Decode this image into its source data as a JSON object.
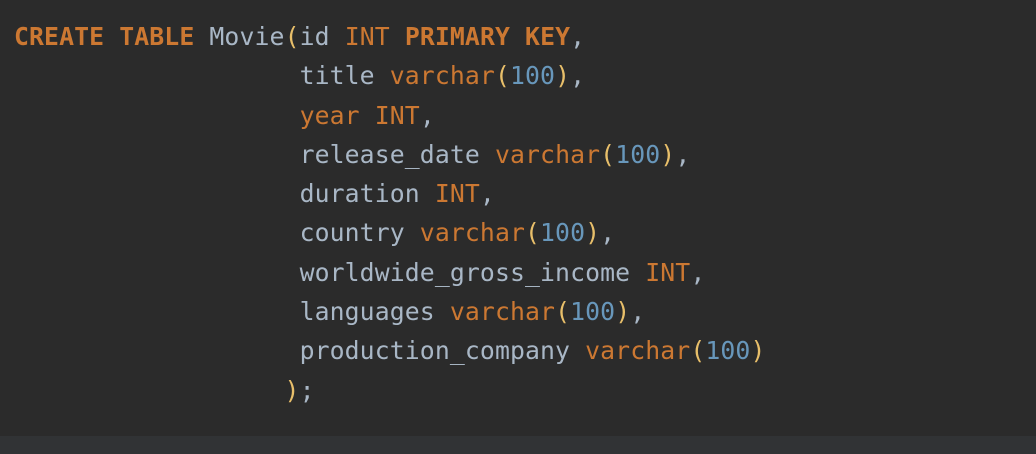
{
  "editor": {
    "colors": {
      "background": "#2b2b2b",
      "keyword": "#cc7832",
      "identifier": "#a9b7c6",
      "paren": "#e8bf6a",
      "number": "#6897bb"
    },
    "lines": [
      {
        "indent": "",
        "tokens": [
          {
            "t": "kw",
            "v": "CREATE"
          },
          {
            "t": "pn",
            "v": " "
          },
          {
            "t": "kw",
            "v": "TABLE"
          },
          {
            "t": "pn",
            "v": " "
          },
          {
            "t": "id",
            "v": "Movie"
          },
          {
            "t": "br",
            "v": "("
          },
          {
            "t": "id",
            "v": "id"
          },
          {
            "t": "pn",
            "v": " "
          },
          {
            "t": "ty",
            "v": "INT"
          },
          {
            "t": "pn",
            "v": " "
          },
          {
            "t": "kw",
            "v": "PRIMARY"
          },
          {
            "t": "pn",
            "v": " "
          },
          {
            "t": "kw",
            "v": "KEY"
          },
          {
            "t": "pn",
            "v": ","
          }
        ]
      },
      {
        "indent": "                   ",
        "tokens": [
          {
            "t": "id",
            "v": "title"
          },
          {
            "t": "pn",
            "v": " "
          },
          {
            "t": "ty",
            "v": "varchar"
          },
          {
            "t": "br",
            "v": "("
          },
          {
            "t": "num",
            "v": "100"
          },
          {
            "t": "br",
            "v": ")"
          },
          {
            "t": "pn",
            "v": ","
          }
        ]
      },
      {
        "indent": "                   ",
        "tokens": [
          {
            "t": "ty",
            "v": "year"
          },
          {
            "t": "pn",
            "v": " "
          },
          {
            "t": "ty",
            "v": "INT"
          },
          {
            "t": "pn",
            "v": ","
          }
        ]
      },
      {
        "indent": "                   ",
        "tokens": [
          {
            "t": "id",
            "v": "release_date"
          },
          {
            "t": "pn",
            "v": " "
          },
          {
            "t": "ty",
            "v": "varchar"
          },
          {
            "t": "br",
            "v": "("
          },
          {
            "t": "num",
            "v": "100"
          },
          {
            "t": "br",
            "v": ")"
          },
          {
            "t": "pn",
            "v": ","
          }
        ]
      },
      {
        "indent": "                   ",
        "tokens": [
          {
            "t": "id",
            "v": "duration"
          },
          {
            "t": "pn",
            "v": " "
          },
          {
            "t": "ty",
            "v": "INT"
          },
          {
            "t": "pn",
            "v": ","
          }
        ]
      },
      {
        "indent": "                   ",
        "tokens": [
          {
            "t": "id",
            "v": "country"
          },
          {
            "t": "pn",
            "v": " "
          },
          {
            "t": "ty",
            "v": "varchar"
          },
          {
            "t": "br",
            "v": "("
          },
          {
            "t": "num",
            "v": "100"
          },
          {
            "t": "br",
            "v": ")"
          },
          {
            "t": "pn",
            "v": ","
          }
        ]
      },
      {
        "indent": "                   ",
        "tokens": [
          {
            "t": "id",
            "v": "worldwide_gross_income"
          },
          {
            "t": "pn",
            "v": " "
          },
          {
            "t": "ty",
            "v": "INT"
          },
          {
            "t": "pn",
            "v": ","
          }
        ]
      },
      {
        "indent": "                   ",
        "tokens": [
          {
            "t": "id",
            "v": "languages"
          },
          {
            "t": "pn",
            "v": " "
          },
          {
            "t": "ty",
            "v": "varchar"
          },
          {
            "t": "br",
            "v": "("
          },
          {
            "t": "num",
            "v": "100"
          },
          {
            "t": "br",
            "v": ")"
          },
          {
            "t": "pn",
            "v": ","
          }
        ]
      },
      {
        "indent": "                   ",
        "tokens": [
          {
            "t": "id",
            "v": "production_company"
          },
          {
            "t": "pn",
            "v": " "
          },
          {
            "t": "ty",
            "v": "varchar"
          },
          {
            "t": "br",
            "v": "("
          },
          {
            "t": "num",
            "v": "100"
          },
          {
            "t": "br",
            "v": ")"
          }
        ]
      },
      {
        "indent": "                  ",
        "tokens": [
          {
            "t": "br",
            "v": ")"
          },
          {
            "t": "pn",
            "v": ";"
          }
        ]
      }
    ]
  }
}
